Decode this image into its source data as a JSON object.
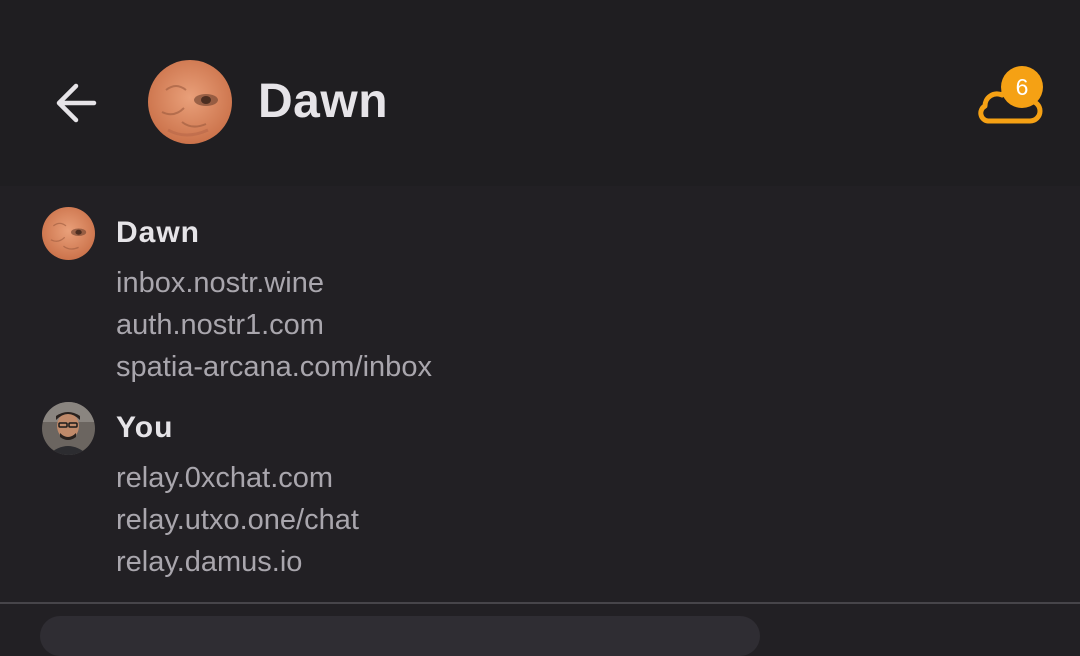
{
  "header": {
    "title": "Dawn",
    "back_icon": "arrow-left-icon",
    "cloud_icon": "cloud-icon",
    "badge_count": "6",
    "accent_color": "#f5a114"
  },
  "groups": [
    {
      "name": "Dawn",
      "relays": [
        "inbox.nostr.wine",
        "auth.nostr1.com",
        "spatia-arcana.com/inbox"
      ]
    },
    {
      "name": "You",
      "relays": [
        "relay.0xchat.com",
        "relay.utxo.one/chat",
        "relay.damus.io"
      ]
    }
  ]
}
